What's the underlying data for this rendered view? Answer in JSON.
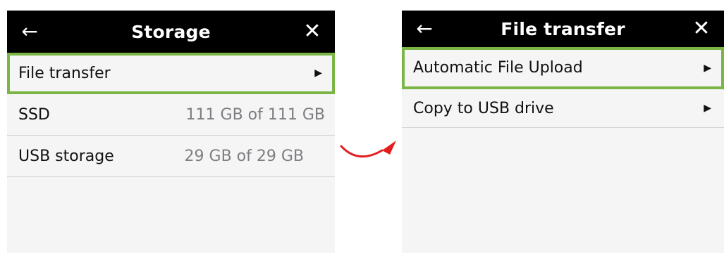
{
  "left_screen": {
    "header": {
      "title": "Storage",
      "back_icon": "left-arrow-icon",
      "close_icon": "close-icon"
    },
    "rows": [
      {
        "label": "File transfer",
        "value": "",
        "chevron": true,
        "selected": true
      },
      {
        "label": "SSD",
        "value": "111 GB of 111 GB",
        "chevron": false,
        "selected": false
      },
      {
        "label": "USB storage",
        "value": "29 GB of 29 GB",
        "chevron": false,
        "selected": false
      }
    ]
  },
  "right_screen": {
    "header": {
      "title": "File transfer",
      "back_icon": "left-arrow-icon",
      "close_icon": "close-icon"
    },
    "rows": [
      {
        "label": "Automatic File Upload",
        "chevron": true,
        "selected": true
      },
      {
        "label": "Copy to USB drive",
        "chevron": true,
        "selected": false
      }
    ]
  },
  "colors": {
    "header_bg": "#000000",
    "highlight": "#7ab545",
    "value_text": "#7e7e82",
    "transition_arrow": "#e41e1e"
  }
}
